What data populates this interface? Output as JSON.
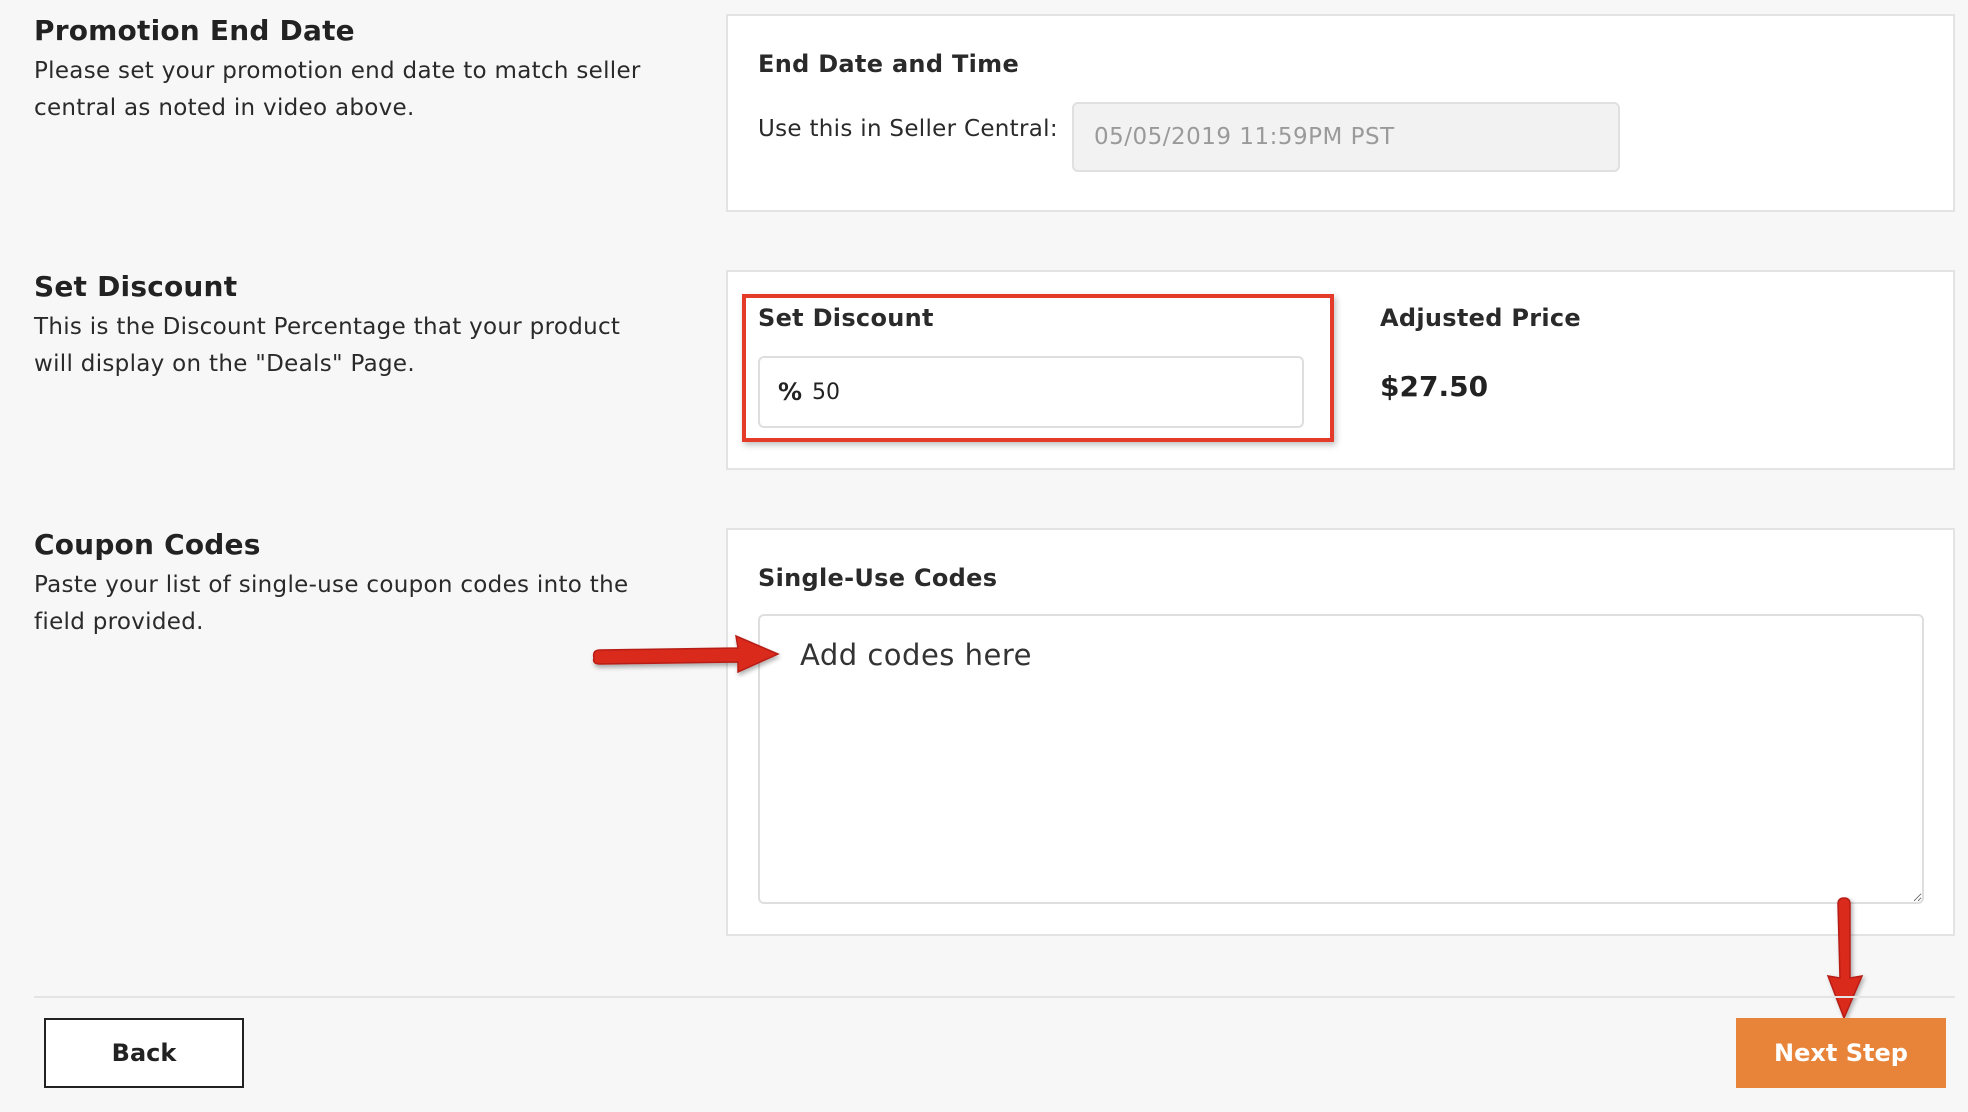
{
  "sections": {
    "end_date": {
      "heading": "Promotion End Date",
      "description": "Please set your promotion end date to match seller central as noted in video above.",
      "panel_title": "End Date and Time",
      "field_label": "Use this in Seller Central:",
      "field_value": "05/05/2019 11:59PM PST"
    },
    "discount": {
      "heading": "Set Discount",
      "description": "This is the Discount Percentage that your product will display on the \"Deals\" Page.",
      "panel_title": "Set Discount",
      "prefix": "%",
      "value": "50",
      "adjusted_price_label": "Adjusted Price",
      "adjusted_price_value": "$27.50"
    },
    "coupons": {
      "heading": "Coupon Codes",
      "description": "Paste your list of single-use coupon codes into the field provided.",
      "panel_title": "Single-Use Codes",
      "placeholder": "Add codes here"
    }
  },
  "buttons": {
    "back": "Back",
    "next": "Next Step"
  },
  "colors": {
    "accent": "#e8843a",
    "highlight": "#e33a2a",
    "arrow": "#d9291c"
  }
}
